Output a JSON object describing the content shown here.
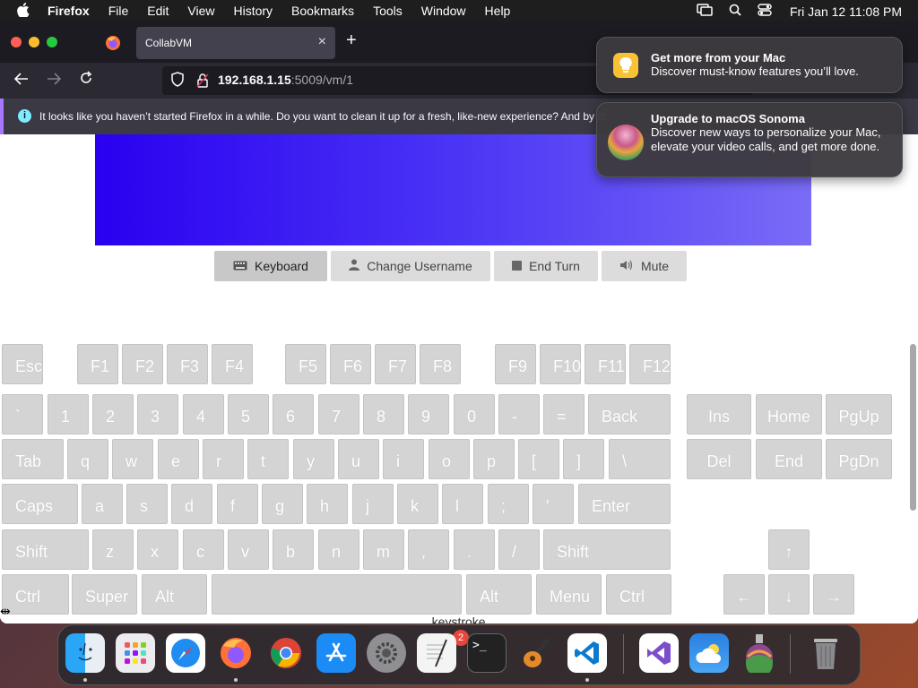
{
  "menubar": {
    "app": "Firefox",
    "items": [
      "File",
      "Edit",
      "View",
      "History",
      "Bookmarks",
      "Tools",
      "Window",
      "Help"
    ],
    "clock": "Fri Jan 12  11:08 PM"
  },
  "browser": {
    "tab_title": "CollabVM",
    "url_host": "192.168.1.15",
    "url_rest": ":5009/vm/1",
    "notification": "It looks like you haven’t started Firefox in a while. Do you want to clean it up for a fresh, like-new experience? And by th"
  },
  "vm_controls": {
    "keyboard": "Keyboard",
    "change_username": "Change Username",
    "end_turn": "End Turn",
    "mute": "Mute"
  },
  "keyboard": {
    "row_function": [
      "Esc",
      "F1",
      "F2",
      "F3",
      "F4",
      "F5",
      "F6",
      "F7",
      "F8",
      "F9",
      "F10",
      "F11",
      "F12"
    ],
    "row_number": [
      "`",
      "1",
      "2",
      "3",
      "4",
      "5",
      "6",
      "7",
      "8",
      "9",
      "0",
      "-",
      "=",
      "Back"
    ],
    "row_tab": [
      "Tab",
      "q",
      "w",
      "e",
      "r",
      "t",
      "y",
      "u",
      "i",
      "o",
      "p",
      "[",
      "]",
      "\\"
    ],
    "row_caps": [
      "Caps",
      "a",
      "s",
      "d",
      "f",
      "g",
      "h",
      "j",
      "k",
      "l",
      ";",
      "'",
      "Enter"
    ],
    "row_shift": [
      "Shift",
      "z",
      "x",
      "c",
      "v",
      "b",
      "n",
      "m",
      ",",
      ".",
      "/",
      "Shift"
    ],
    "row_ctrl": [
      "Ctrl",
      "Super",
      "Alt",
      "",
      "Alt",
      "Menu",
      "Ctrl"
    ],
    "nav_top": [
      "Ins",
      "Home",
      "PgUp"
    ],
    "nav_bottom": [
      "Del",
      "End",
      "PgDn"
    ],
    "arrows": [
      "↑",
      "←",
      "↓",
      "→"
    ]
  },
  "below_text": "...keystroke...",
  "notifications": [
    {
      "title": "Get more from your Mac",
      "text": "Discover must-know features you’ll love."
    },
    {
      "title": "Upgrade to macOS Sonoma",
      "text": "Discover new ways to personalize your Mac, elevate your video calls, and get more done."
    }
  ],
  "dock": {
    "settings_badge": "2",
    "apps": [
      "finder-icon",
      "launchpad-icon",
      "safari-icon",
      "firefox-icon",
      "chrome-icon",
      "app-store-icon",
      "system-settings-icon",
      "textedit-icon",
      "terminal-icon",
      "garageband-icon",
      "vscode-icon",
      "visual-studio-icon",
      "weather-icon",
      "macos-installer-icon",
      "trash-icon"
    ]
  },
  "colors": {
    "vm_gradient_start": "#2a00f0",
    "vm_gradient_end": "#7a6cf6",
    "key_bg": "#d4d4d4"
  }
}
